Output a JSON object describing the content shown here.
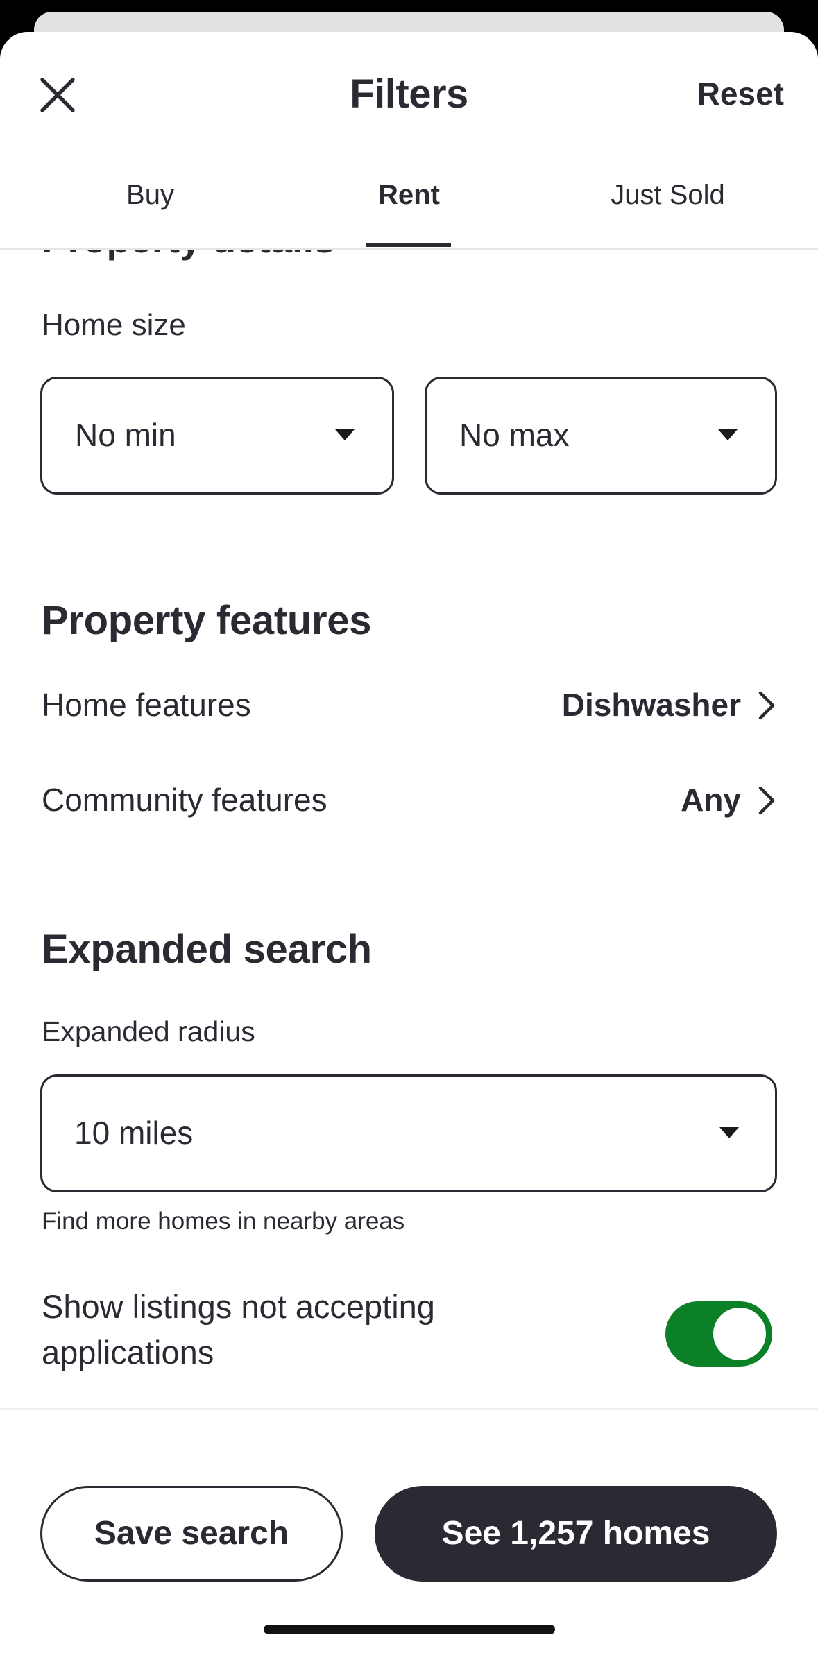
{
  "header": {
    "title": "Filters",
    "reset_label": "Reset",
    "close_icon": "close-icon"
  },
  "tabs": [
    {
      "label": "Buy",
      "active": false
    },
    {
      "label": "Rent",
      "active": true
    },
    {
      "label": "Just Sold",
      "active": false
    }
  ],
  "property_details": {
    "heading": "Property details",
    "home_size_label": "Home size",
    "min_value": "No min",
    "max_value": "No max"
  },
  "property_features": {
    "heading": "Property features",
    "home_features": {
      "label": "Home features",
      "value": "Dishwasher"
    },
    "community_features": {
      "label": "Community features",
      "value": "Any"
    }
  },
  "expanded_search": {
    "heading": "Expanded search",
    "radius_label": "Expanded radius",
    "radius_value": "10 miles",
    "helper": "Find more homes in nearby areas",
    "toggle_label": "Show listings not accepting applications",
    "toggle_on": true
  },
  "footer": {
    "save_label": "Save search",
    "see_label": "See 1,257 homes"
  },
  "colors": {
    "text": "#2a2a33",
    "toggle_on": "#0b8027",
    "primary_button": "#2a2a33"
  }
}
